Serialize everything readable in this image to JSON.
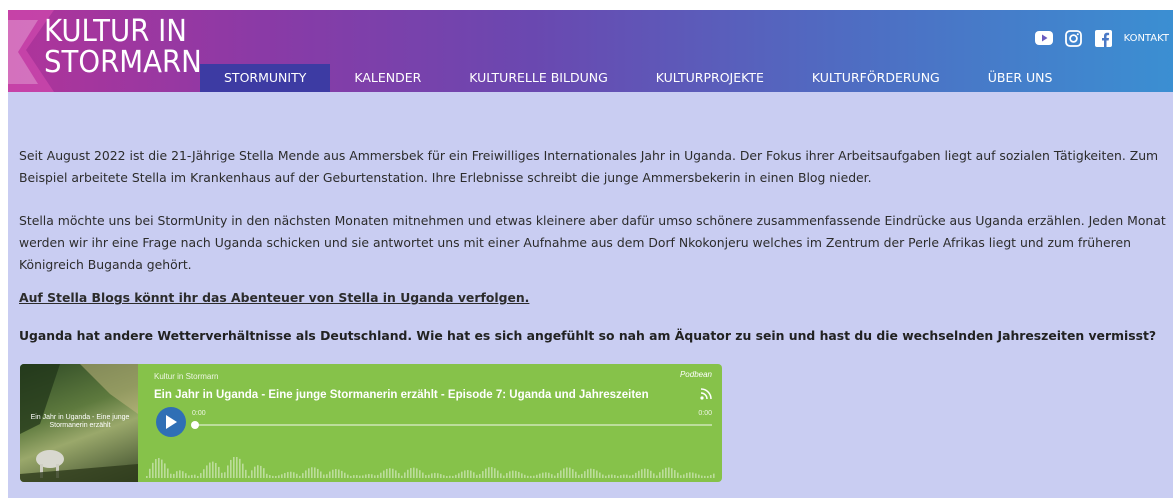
{
  "logo": {
    "line1": "KULTUR IN",
    "line2": "STORMARN"
  },
  "nav": {
    "items": [
      {
        "label": "STORMUNITY"
      },
      {
        "label": "KALENDER"
      },
      {
        "label": "KULTURELLE BILDUNG"
      },
      {
        "label": "KULTURPROJEKTE"
      },
      {
        "label": "KULTURFÖRDERUNG"
      },
      {
        "label": "ÜBER UNS"
      }
    ]
  },
  "social": {
    "youtube": "youtube-icon",
    "instagram": "instagram-icon",
    "facebook": "facebook-icon",
    "kontakt": "KONTAKT"
  },
  "colors": {
    "accent_nav": "#3d3ba3",
    "content_bg": "#c9cdf2",
    "player_bg": "#86c24a",
    "play_button": "#2f6fb5"
  },
  "article": {
    "para1": "Seit August 2022 ist die 21-Jährige Stella Mende aus Ammersbek für ein Freiwilliges Internationales Jahr in Uganda. Der Fokus ihrer Arbeitsaufgaben liegt auf sozialen Tätigkeiten. Zum Beispiel arbeitete Stella im Krankenhaus auf der Geburtenstation. Ihre Erlebnisse schreibt die junge Ammersbekerin in einen Blog nieder.",
    "para2": "Stella möchte uns bei StormUnity in den nächsten Monaten mitnehmen und etwas kleinere aber dafür umso schönere zusammenfassende Eindrücke aus Uganda erzählen. Jeden Monat werden wir ihr eine Frage nach Uganda schicken und sie antwortet uns mit einer Aufnahme aus dem Dorf Nkokonjeru welches im Zentrum der Perle Afrikas liegt und zum früheren Königreich Buganda gehört.",
    "link": "Auf Stella Blogs könnt ihr das Abenteuer von Stella in Uganda verfolgen.",
    "question": "Uganda hat andere Wetterverhältnisse als Deutschland. Wie hat es sich angefühlt so nah am Äquator zu sein und hast du die wechselnden Jahreszeiten vermisst?"
  },
  "player": {
    "channel": "Kultur in Stormarn",
    "title": "Ein Jahr in Uganda - Eine junge Stormanerin erzählt - Episode 7: Uganda und Jahreszeiten",
    "brand": "Podbean",
    "cover_text": "Ein Jahr in Uganda - Eine junge Stormanerin erzählt",
    "time_start": "0:00",
    "time_end": "0:00",
    "progress": 0
  }
}
